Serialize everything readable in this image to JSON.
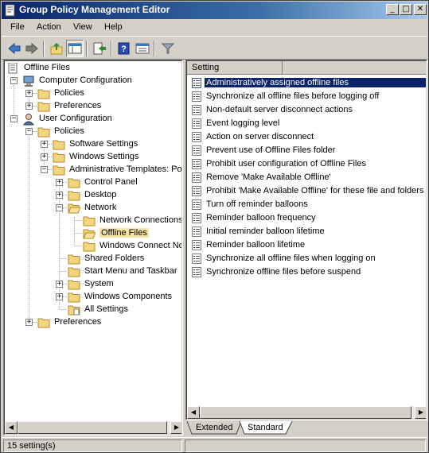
{
  "window": {
    "title": "Group Policy Management Editor"
  },
  "menubar": {
    "items": [
      "File",
      "Action",
      "View",
      "Help"
    ]
  },
  "toolbar": {
    "buttons": [
      "back-icon",
      "forward-icon",
      "up-icon",
      "show-hide-tree-icon",
      "export-icon",
      "help-icon",
      "properties-icon",
      "filter-icon"
    ]
  },
  "tree": {
    "items": [
      {
        "label": "Offline Files"
      },
      {
        "label": "Computer Configuration"
      },
      {
        "label": "Policies"
      },
      {
        "label": "Preferences"
      },
      {
        "label": "User Configuration"
      },
      {
        "label": "Policies"
      },
      {
        "label": "Software Settings"
      },
      {
        "label": "Windows Settings"
      },
      {
        "label": "Administrative Templates: Pol"
      },
      {
        "label": "Control Panel"
      },
      {
        "label": "Desktop"
      },
      {
        "label": "Network"
      },
      {
        "label": "Network Connections"
      },
      {
        "label": "Offline Files"
      },
      {
        "label": "Windows Connect Now"
      },
      {
        "label": "Shared Folders"
      },
      {
        "label": "Start Menu and Taskbar"
      },
      {
        "label": "System"
      },
      {
        "label": "Windows Components"
      },
      {
        "label": "All Settings"
      },
      {
        "label": "Preferences"
      }
    ]
  },
  "list": {
    "column_header": "Setting",
    "items": [
      "Administratively assigned offline files",
      "Synchronize all offline files before logging off",
      "Non-default server disconnect actions",
      "Event logging level",
      "Action on server disconnect",
      "Prevent use of Offline Files folder",
      "Prohibit user configuration of Offline Files",
      "Remove 'Make Available Offline'",
      "Prohibit 'Make Available Offline' for these file and folders",
      "Turn off reminder balloons",
      "Reminder balloon frequency",
      "Initial reminder balloon lifetime",
      "Reminder balloon lifetime",
      "Synchronize all offline files when logging on",
      "Synchronize offline files before suspend"
    ]
  },
  "tabs": {
    "extended": "Extended",
    "standard": "Standard"
  },
  "status": {
    "text": "15 setting(s)"
  },
  "colors": {
    "selection": "#0a246a",
    "tree_selection": "#f4e3a4",
    "folder": "#f4d57a"
  }
}
